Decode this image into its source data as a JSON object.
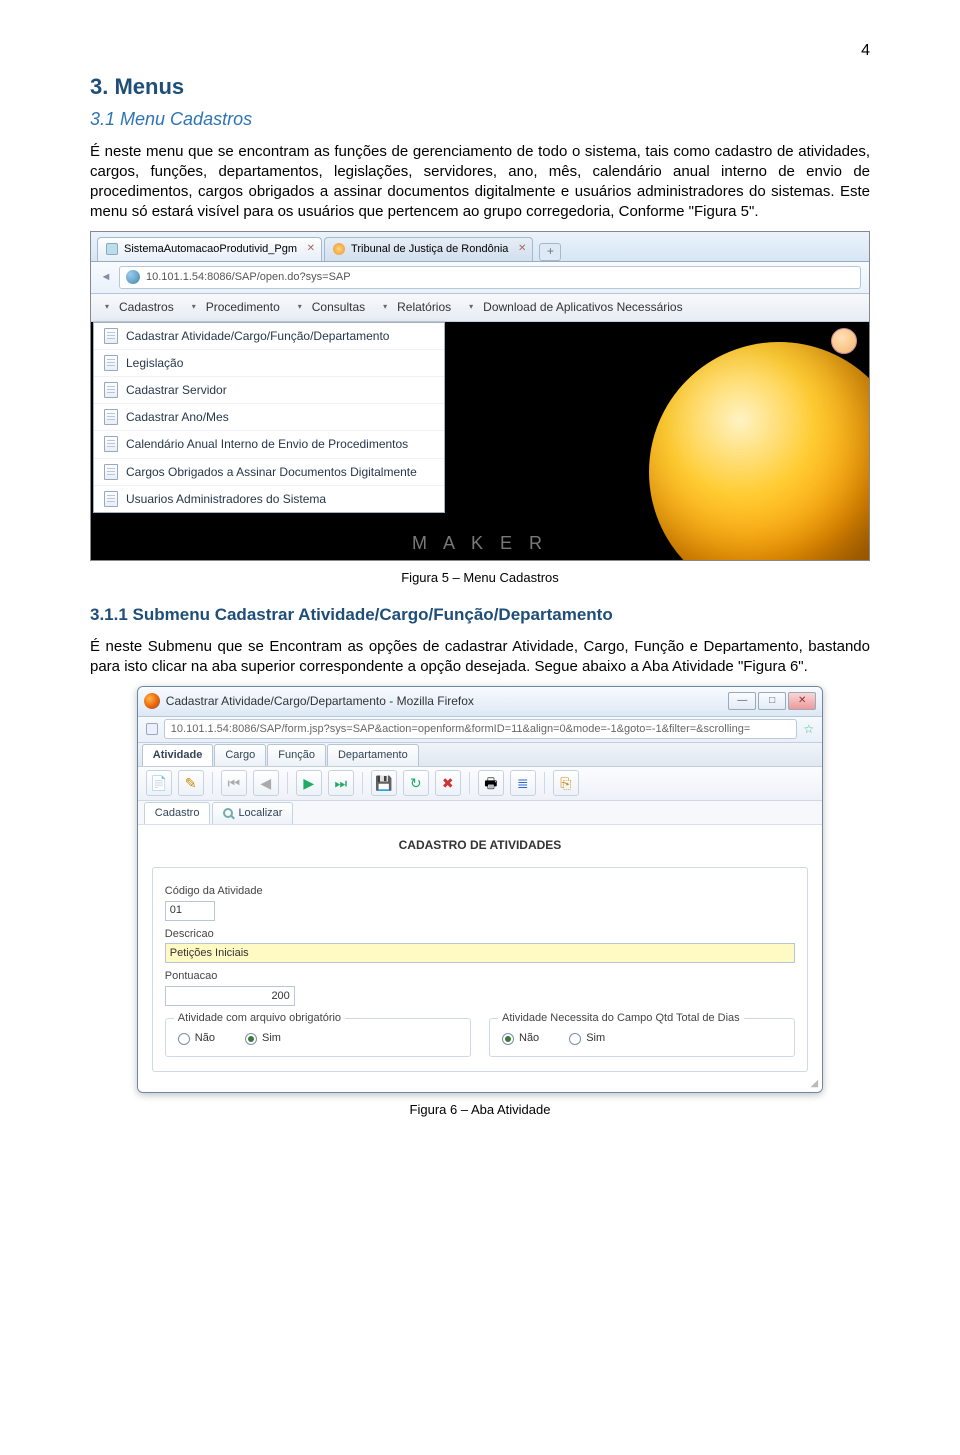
{
  "page_number": "4",
  "h_menus": "3. Menus",
  "h_menu_cadastros": "3.1   Menu Cadastros",
  "p1": "É neste menu que se encontram as funções de gerenciamento de todo o sistema, tais como cadastro de atividades, cargos, funções, departamentos, legislações, servidores, ano, mês, calendário anual interno de envio de procedimentos, cargos obrigados a assinar documentos digitalmente e usuários administradores do sistemas. Este menu só estará visível para os usuários que pertencem ao grupo corregedoria, Conforme \"Figura 5\".",
  "fig5_caption": "Figura 5 – Menu Cadastros",
  "h_submenu": "3.1.1  Submenu Cadastrar Atividade/Cargo/Função/Departamento",
  "p2": "É neste Submenu que se Encontram as opções de cadastrar Atividade, Cargo, Função e Departamento, bastando para isto clicar na aba superior correspondente a opção desejada. Segue abaixo a Aba Atividade \"Figura 6\".",
  "fig6_caption": "Figura 6 – Aba Atividade",
  "ss1": {
    "tab1": "SistemaAutomacaoProdutivid_Pgm",
    "tab2": "Tribunal de Justiça de Rondônia",
    "plus": "+",
    "url": "10.101.1.54:8086/SAP/open.do?sys=SAP",
    "menu": {
      "cadastros": "Cadastros",
      "procedimento": "Procedimento",
      "consultas": "Consultas",
      "relatorios": "Relatórios",
      "download": "Download de Aplicativos Necessários"
    },
    "dropdown": [
      "Cadastrar Atividade/Cargo/Função/Departamento",
      "Legislação",
      "Cadastrar Servidor",
      "Cadastrar Ano/Mes",
      "Calendário Anual Interno de Envio de Procedimentos",
      "Cargos Obrigados a Assinar Documentos Digitalmente",
      "Usuarios Administradores do Sistema"
    ],
    "maker": "M A K E R"
  },
  "ss2": {
    "title": "Cadastrar Atividade/Cargo/Departamento - Mozilla Firefox",
    "url": "10.101.1.54:8086/SAP/form.jsp?sys=SAP&action=openform&formID=11&align=0&mode=-1&goto=-1&filter=&scrolling=",
    "tabs": [
      "Atividade",
      "Cargo",
      "Função",
      "Departamento"
    ],
    "subtabs": {
      "cadastro": "Cadastro",
      "localizar": "Localizar"
    },
    "form_title": "CADASTRO DE ATIVIDADES",
    "labels": {
      "codigo": "Código da Atividade",
      "descricao": "Descricao",
      "pontuacao": "Pontuacao",
      "group1": "Atividade com arquivo obrigatório",
      "group2": "Atividade Necessita do Campo Qtd Total de Dias",
      "nao": "Não",
      "sim": "Sim"
    },
    "values": {
      "codigo": "01",
      "descricao": "Petições Iniciais",
      "pontuacao": "200"
    },
    "winbtns": {
      "min": "—",
      "max": "□",
      "close": "✕"
    }
  }
}
